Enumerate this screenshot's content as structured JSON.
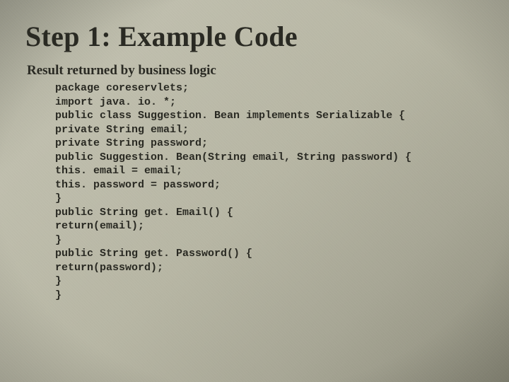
{
  "title": "Step 1: Example Code",
  "subtitle": "Result returned by business logic",
  "code_lines": [
    "package coreservlets;",
    "import java. io. *;",
    "public class Suggestion. Bean implements Serializable {",
    "private String email;",
    "private String password;",
    "public Suggestion. Bean(String email, String password) {",
    "this. email = email;",
    "this. password = password;",
    "}",
    "public String get. Email() {",
    "return(email);",
    "}",
    "public String get. Password() {",
    "return(password);",
    "}",
    "}"
  ]
}
